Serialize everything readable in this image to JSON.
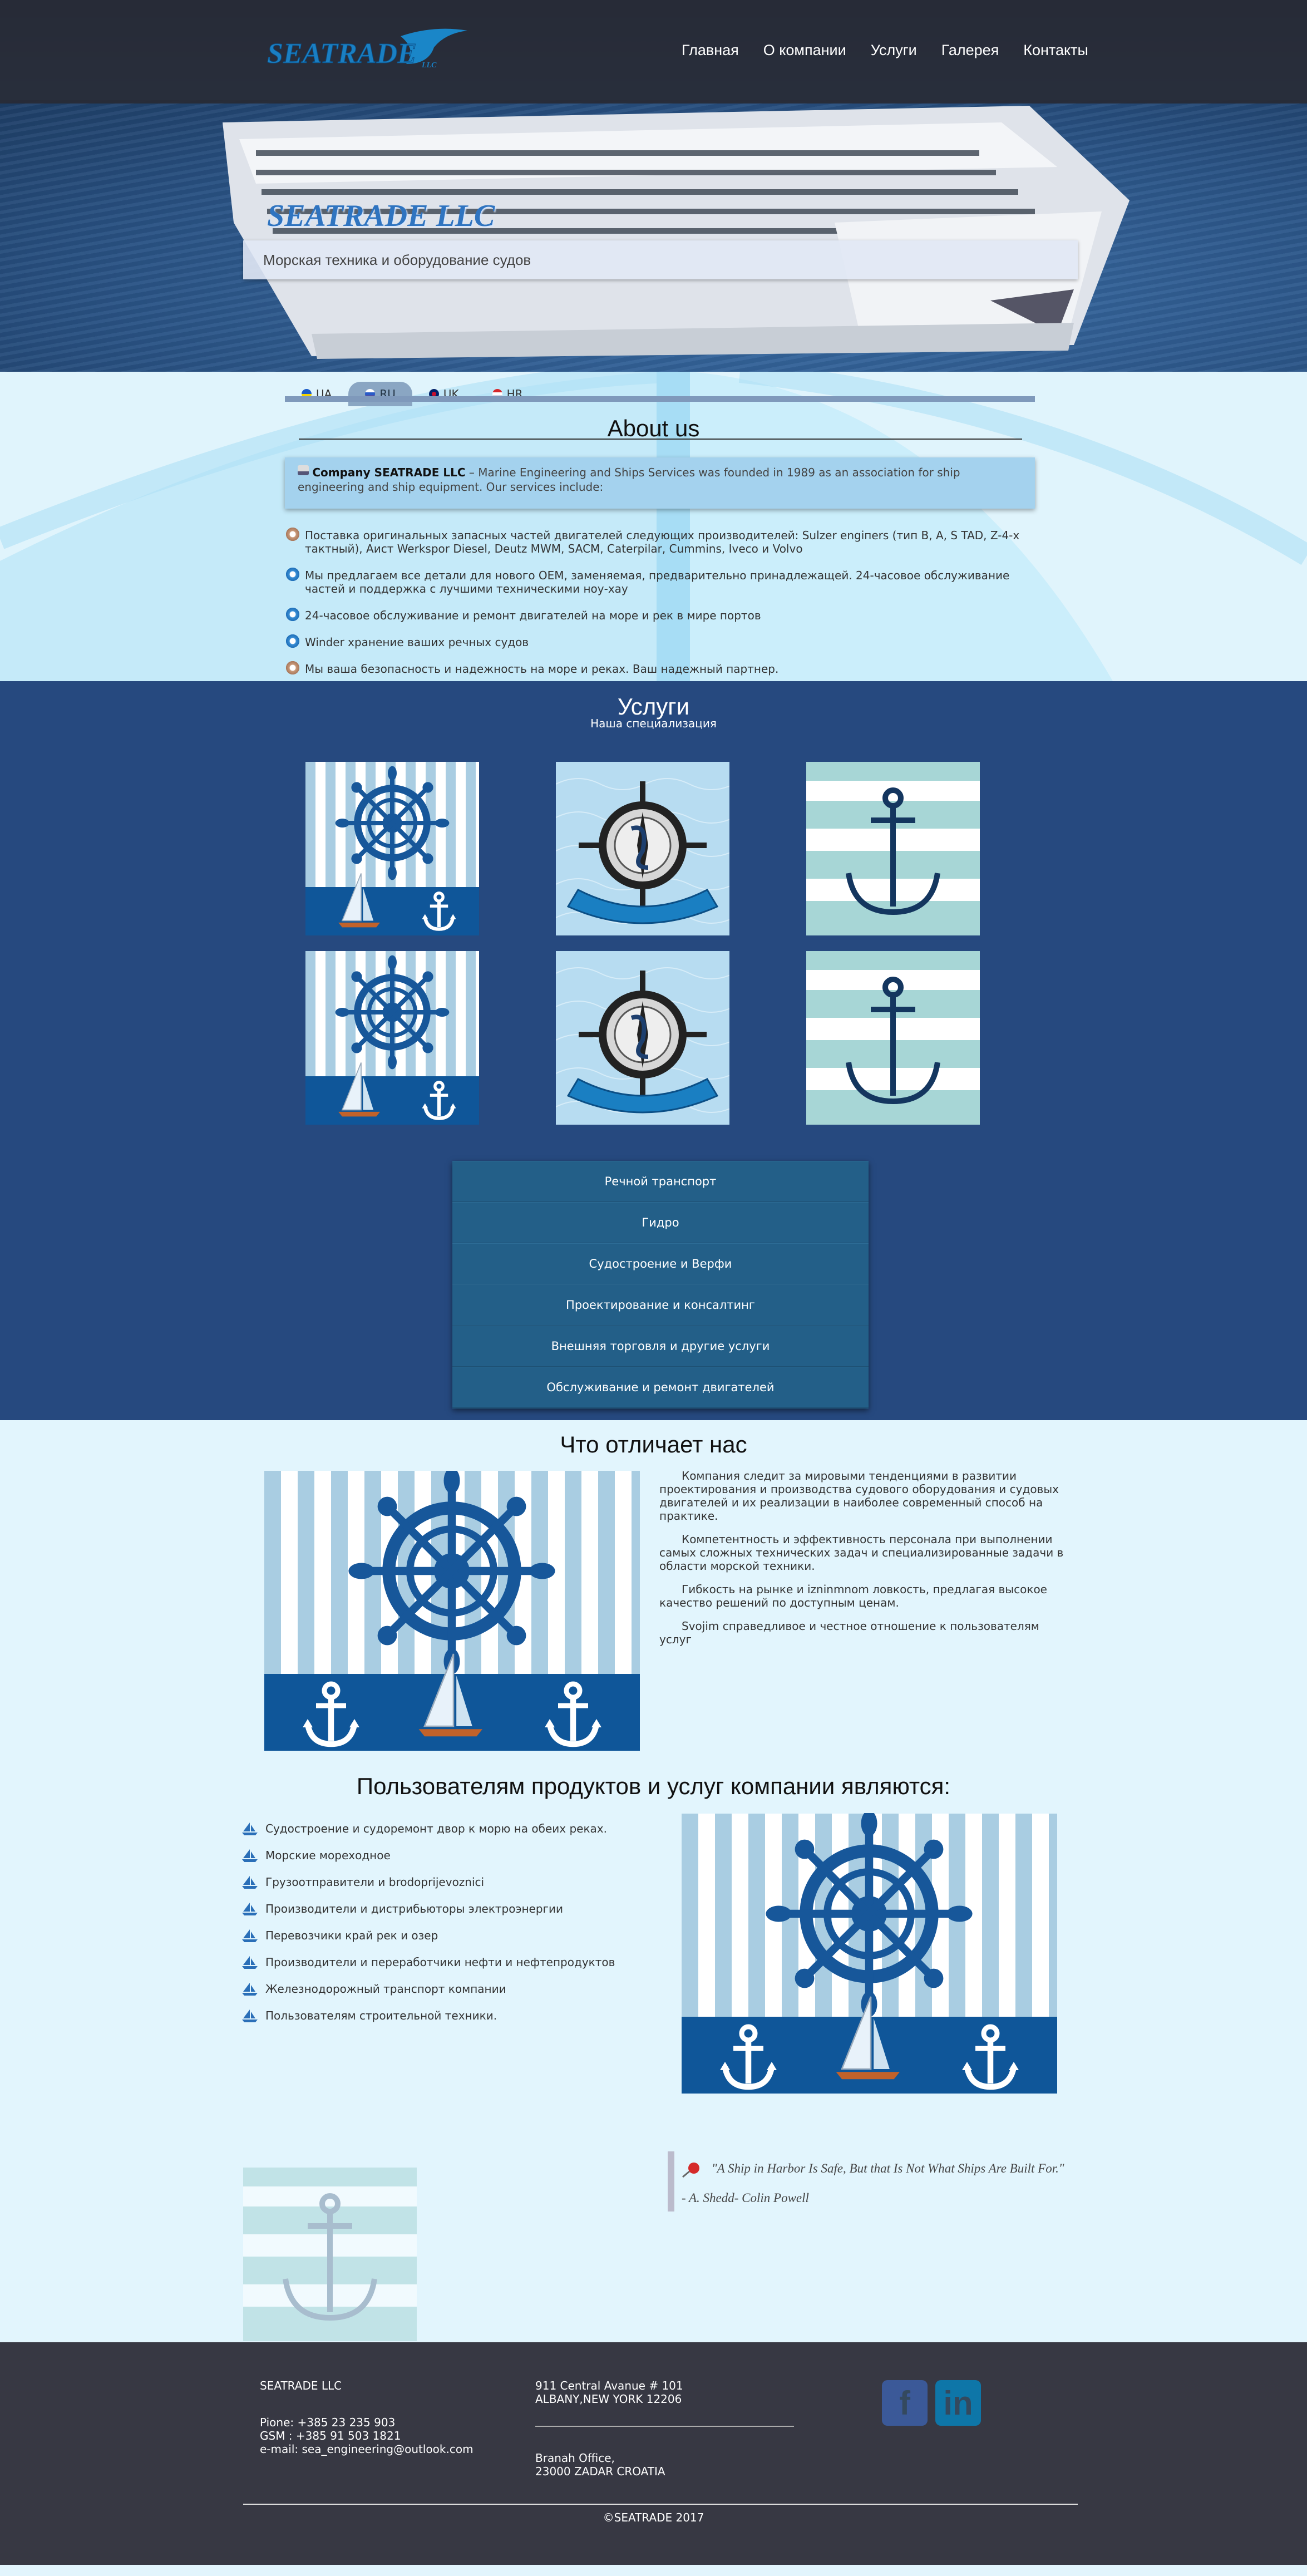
{
  "header": {
    "logo_text": "SEATRADE",
    "logo_suffix": "LLC",
    "nav": [
      {
        "label": "Главная"
      },
      {
        "label": "О компании"
      },
      {
        "label": "Услуги"
      },
      {
        "label": "Галерея"
      },
      {
        "label": "Контакты"
      }
    ]
  },
  "hero": {
    "title": "SEATRADE LLC",
    "subtitle": "Морская техника и оборудование судов"
  },
  "about": {
    "languages": [
      {
        "code": "UA",
        "active": false
      },
      {
        "code": "RU",
        "active": true
      },
      {
        "code": "UK",
        "active": false
      },
      {
        "code": "HR",
        "active": false
      }
    ],
    "title": "About us",
    "intro_company": "Company SEATRADE LLC",
    "intro_text": " – Marine Engineering and Ships Services was founded in 1989 as an association for ship engineering and ship equipment. Our services include:",
    "bullets": [
      {
        "icon": "gear-icon",
        "text": "Поставка оригинальных запасных частей двигателей следующих производителей: Sulzer engiпers (тип B, A, S TAD, Z-4-x тактный), Aист Werkspor Diesel, Deutz MWM, SACM, Caterpilar, Cummins, Iveco и Volvo"
      },
      {
        "icon": "gear-blue-icon",
        "text": "Мы предлагаем все детали для нового OEM, заменяемая, предварительно принадлежащей. 24-часовое обслуживание частей и поддержка с лучшими техническими ноу-хау"
      },
      {
        "icon": "gear-blue-icon",
        "text": "24-часовое обслуживание и ремонт двигателей на море и рек в мире портов"
      },
      {
        "icon": "gear-blue-icon",
        "text": "Winder хранение ваших речных судов"
      },
      {
        "icon": "gear-icon",
        "text": "Мы ваша безопасность и надежность на море и реках. Ваш надежный партнер."
      }
    ]
  },
  "services": {
    "title": "Услуги",
    "subtitle": "Наша специализация",
    "menu": [
      {
        "label": "Речной транспорт"
      },
      {
        "label": "Гидро"
      },
      {
        "label": "Судостроение и Верфи"
      },
      {
        "label": "Проектирование и консалтинг"
      },
      {
        "label": "Внешняя торговля и другие услуги"
      },
      {
        "label": "Обслуживание и ремонт двигателей"
      }
    ]
  },
  "differs": {
    "title": "Что отличает нас",
    "paragraphs": [
      "Компания следит за мировыми тенденциями в развитии проектирования и производства судового оборудования и судовых двигателей и их реализации в наиболее современный способ на практике.",
      "Компетентность и эффективность персонала при выполнении самых сложных технических задач и специализированные задачи в области морской техники.",
      "Гибкость на рынке и izninmnom ловкость, предлагая высокое качество решений по доступным ценам.",
      "Svojim справедливое и честное отношение к пользователям услуг"
    ]
  },
  "users": {
    "title": "Пользователям продуктов и услуг компании являются:",
    "items": [
      "Судостроение и судоремонт двор к морю на обеих реках.",
      "Морские мореходное",
      "Грузоотправители и brodoprijevoznici",
      "Производители и дистрибьюторы электроэнергии",
      "Перевозчики край рек и озер",
      "Производители и переработчики нефти и нефтепродуктов",
      "Железнодорожный транспорт компании",
      "Пользователям строительной техники."
    ]
  },
  "quote": {
    "text": "\"A Ship in Harbor Is Safe, But that Is Not What Ships Are Built For.\" - A. Shedd- Colin Powell"
  },
  "footer": {
    "company": "SEATRADE LLC",
    "phone": "Pione: +385 23 235 903",
    "gsm": "GSM : +385 91 503 1821",
    "email": "e-mail: sea_engineering@outlook.com",
    "address1_line1": "911 Central Avanue # 101",
    "address1_line2": "ALBANY,NEW YORK 12206",
    "address2_line1": "Branah Office,",
    "address2_line2": "23000 ZADAR CROATIA",
    "social": [
      {
        "icon": "facebook-icon",
        "label": "f",
        "color": "#3b5998"
      },
      {
        "icon": "linkedin-icon",
        "label": "in",
        "color": "#0e76a8"
      }
    ],
    "copyright": "©SEATRADE 2017"
  },
  "colors": {
    "services_bg": "#26497f",
    "about_bg": "#e0f4fc",
    "footer_bg": "#373843",
    "accent": "#2f74c0"
  }
}
